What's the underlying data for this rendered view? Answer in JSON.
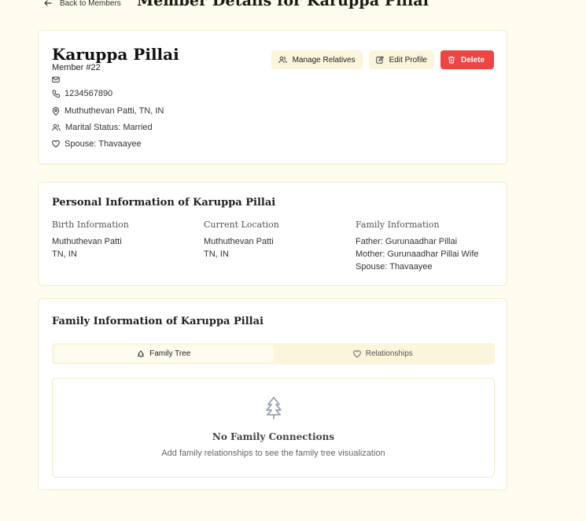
{
  "header": {
    "back_label": "Back to Members",
    "title": "Member Details for Karuppa Pillai"
  },
  "profile": {
    "name": "Karuppa Pillai",
    "member_number": "Member #22",
    "email": "",
    "phone": "1234567890",
    "location": "Muthuthevan Patti, TN, IN",
    "marital_status": "Marital Status: Married",
    "spouse": "Spouse: Thavaayee",
    "actions": {
      "manage_relatives": "Manage Relatives",
      "edit_profile": "Edit Profile",
      "delete": "Delete"
    }
  },
  "personal": {
    "title": "Personal Information of Karuppa Pillai",
    "birth": {
      "heading": "Birth Information",
      "line1": "Muthuthevan Patti",
      "line2": "TN, IN"
    },
    "current": {
      "heading": "Current Location",
      "line1": "Muthuthevan Patti",
      "line2": "TN, IN"
    },
    "family": {
      "heading": "Family Information",
      "father": "Father: Gurunaadhar Pillai",
      "mother": "Mother: Gurunaadhar Pillai Wife",
      "spouse": "Spouse: Thavaayee"
    }
  },
  "family_section": {
    "title": "Family Information of Karuppa Pillai",
    "tabs": [
      {
        "label": "Family Tree",
        "active": true,
        "icon": "tree-icon"
      },
      {
        "label": "Relationships",
        "active": false,
        "icon": "heart-icon"
      }
    ],
    "empty": {
      "title": "No Family Connections",
      "description": "Add family relationships to see the family tree visualization"
    }
  },
  "colors": {
    "background": "#fefcee",
    "card_border": "#f2ecc9",
    "soft_button": "#fbf5dc",
    "danger": "#ef4444"
  }
}
